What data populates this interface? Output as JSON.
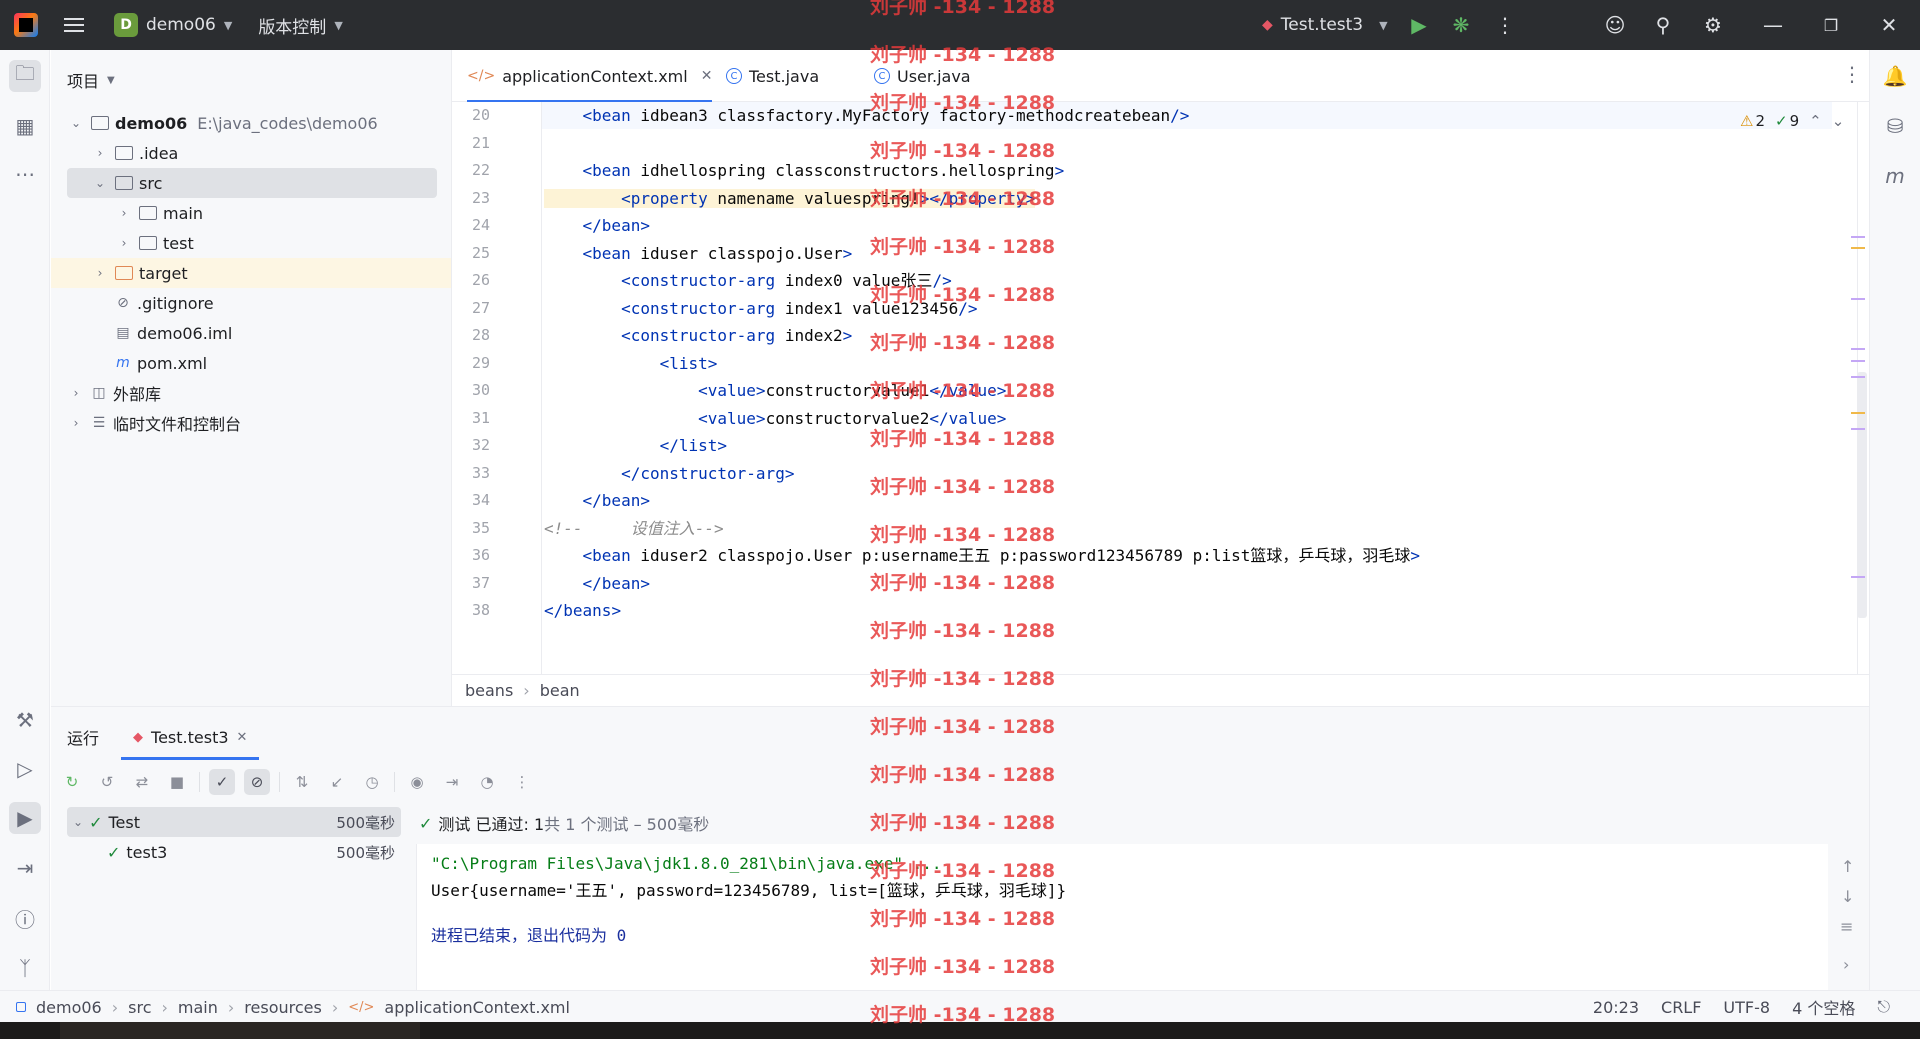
{
  "titlebar": {
    "project_badge": "D",
    "project_name": "demo06",
    "vcs": "版本控制",
    "run_config": "Test.test3"
  },
  "project_panel": {
    "title": "项目",
    "tree": [
      {
        "label": "demo06",
        "path": "E:\\java_codes\\demo06"
      },
      {
        "label": ".idea"
      },
      {
        "label": "src"
      },
      {
        "label": "main"
      },
      {
        "label": "test"
      },
      {
        "label": "target"
      },
      {
        "label": ".gitignore"
      },
      {
        "label": "demo06.iml"
      },
      {
        "label": "pom.xml"
      },
      {
        "label": "外部库"
      },
      {
        "label": "临时文件和控制台"
      }
    ]
  },
  "tabs": [
    {
      "label": "applicationContext.xml"
    },
    {
      "label": "Test.java"
    },
    {
      "label": "User.java"
    }
  ],
  "inspections": {
    "warnings": "2",
    "ok": "9"
  },
  "editor": {
    "line_numbers": [
      "20",
      "21",
      "22",
      "23",
      "24",
      "25",
      "26",
      "27",
      "28",
      "29",
      "30",
      "31",
      "32",
      "33",
      "34",
      "35",
      "36",
      "37",
      "38"
    ],
    "lines": [
      "    <bean id=\"bean3\" class=\"factory.MyFactory\" factory-method=\"createbean\"/>",
      "",
      "    <bean id=\"hellospring\" class=\"constructors.hellospring\">",
      "        <property name=\"name\" value=\"spring!\"></property>",
      "    </bean>",
      "    <bean id=\"user\" class=\"pojo.User\">",
      "        <constructor-arg index=\"0\" value=\"张三\"/>",
      "        <constructor-arg index=\"1\" value=\"123456\"/>",
      "        <constructor-arg index=\"2\">",
      "            <list>",
      "                <value>constructorvalue1</value>",
      "                <value>constructorvalue2</value>",
      "            </list>",
      "        </constructor-arg>",
      "    </bean>",
      "<!--     设值注入-->",
      "    <bean id=\"user2\" class=\"pojo.User\" p:username=\"王五\" p:password=\"123456789\" p:list=\"篮球，乒乓球，羽毛球\">",
      "    </bean>",
      "</beans>"
    ]
  },
  "editor_breadcrumb": [
    "beans",
    "bean"
  ],
  "run_panel": {
    "label": "运行",
    "tab": "Test.test3",
    "tests": [
      {
        "name": "Test",
        "duration": "500毫秒"
      },
      {
        "name": "test3",
        "duration": "500毫秒"
      }
    ],
    "status_prefix": "测试 已通过: 1",
    "status_suffix": "共 1 个测试 – 500毫秒",
    "console": [
      "\"C:\\Program Files\\Java\\jdk1.8.0_281\\bin\\java.exe\" ...",
      "User{username='王五', password=123456789, list=[篮球，乒乓球，羽毛球]}",
      "",
      "进程已结束，退出代码为 0"
    ]
  },
  "statusbar": {
    "crumbs": [
      "demo06",
      "src",
      "main",
      "resources",
      "applicationContext.xml"
    ],
    "position": "20:23",
    "line_sep": "CRLF",
    "encoding": "UTF-8",
    "indent": "4 个空格"
  },
  "watermark": "刘子帅 -134 - 1288"
}
